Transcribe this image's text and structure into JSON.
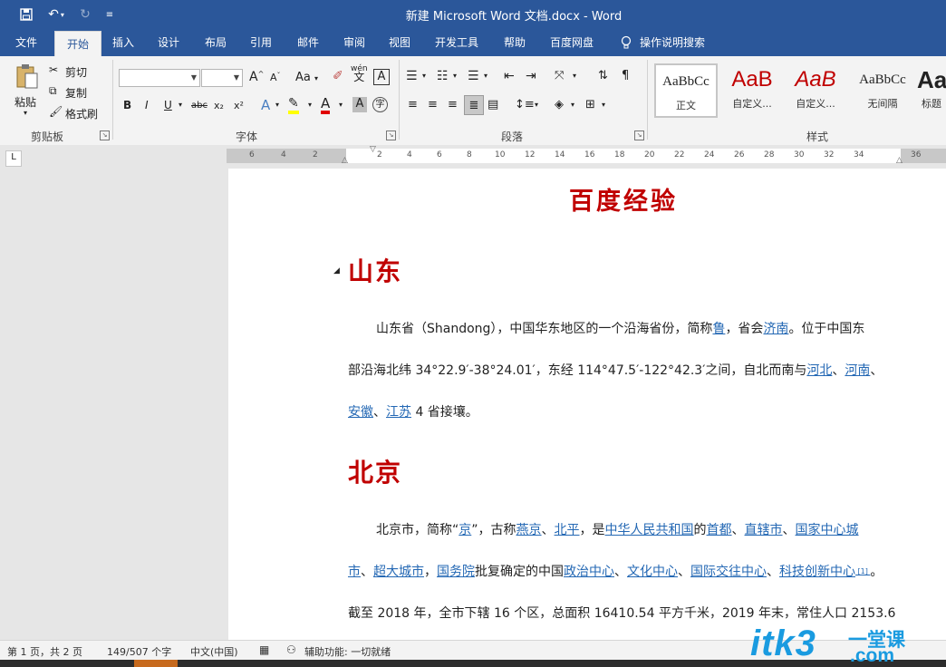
{
  "window": {
    "title": "新建 Microsoft Word 文档.docx  -  Word"
  },
  "tabs": [
    "文件",
    "开始",
    "插入",
    "设计",
    "布局",
    "引用",
    "邮件",
    "审阅",
    "视图",
    "开发工具",
    "帮助",
    "百度网盘"
  ],
  "tell_me": "操作说明搜索",
  "clipboard": {
    "paste": "粘贴",
    "cut": "剪切",
    "copy": "复制",
    "format_painter": "格式刷",
    "group": "剪贴板"
  },
  "font": {
    "group": "字体",
    "font_name": "",
    "font_size": "",
    "change_case": "Aa",
    "wen": "wén",
    "wen_char": "文",
    "char_border": "A",
    "grow": "A",
    "shrink": "A",
    "bold": "B",
    "italic": "I",
    "underline": "U",
    "strike": "abc",
    "subscript": "x₂",
    "superscript": "x²",
    "text_effects": "A",
    "font_color": "A",
    "char_shading": "A",
    "enclose": "字"
  },
  "paragraph": {
    "group": "段落"
  },
  "styles": {
    "group": "样式",
    "items": [
      {
        "preview": "AaBbCc",
        "name": "正文"
      },
      {
        "preview": "AaB",
        "name": "自定义..."
      },
      {
        "preview": "AaB",
        "name": "自定义..."
      },
      {
        "preview": "AaBbCc",
        "name": "无间隔"
      },
      {
        "preview": "Aa",
        "name": "标题"
      }
    ]
  },
  "ruler": {
    "left_labels": [
      "6",
      "4",
      "2"
    ],
    "right_labels": [
      "2",
      "4",
      "6",
      "8",
      "10",
      "12",
      "14",
      "16",
      "18",
      "20",
      "22",
      "24",
      "26",
      "28",
      "30",
      "32",
      "34",
      "36"
    ]
  },
  "document": {
    "title": "百度经验",
    "sections": [
      {
        "heading": "山东",
        "lines": [
          [
            {
              "t": "山东省（Shandong），中国华东地区的一个沿海省份，简称"
            },
            {
              "t": "鲁",
              "link": true
            },
            {
              "t": "，省会"
            },
            {
              "t": "济南",
              "link": true
            },
            {
              "t": "。位于中国东"
            }
          ],
          [
            {
              "t": "部沿海北纬 34°22.9′-38°24.01′，东经 114°47.5′-122°42.3′之间，自北而南与"
            },
            {
              "t": "河北",
              "link": true
            },
            {
              "t": "、"
            },
            {
              "t": "河南",
              "link": true
            },
            {
              "t": "、"
            }
          ],
          [
            {
              "t": "安徽",
              "link": true
            },
            {
              "t": "、"
            },
            {
              "t": "江苏",
              "link": true
            },
            {
              "t": " 4 省接壤。"
            }
          ]
        ]
      },
      {
        "heading": "北京",
        "lines": [
          [
            {
              "t": "北京市，简称“"
            },
            {
              "t": "京",
              "link": true
            },
            {
              "t": "”，古称"
            },
            {
              "t": "燕京",
              "link": true
            },
            {
              "t": "、"
            },
            {
              "t": "北平",
              "link": true
            },
            {
              "t": "，是"
            },
            {
              "t": "中华人民共和国",
              "link": true
            },
            {
              "t": "的"
            },
            {
              "t": "首都",
              "link": true
            },
            {
              "t": "、"
            },
            {
              "t": "直辖市",
              "link": true
            },
            {
              "t": "、"
            },
            {
              "t": "国家中心城",
              "link": true
            }
          ],
          [
            {
              "t": "市",
              "link": true
            },
            {
              "t": "、"
            },
            {
              "t": "超大城市",
              "link": true
            },
            {
              "t": "，"
            },
            {
              "t": "国务院",
              "link": true
            },
            {
              "t": "批复确定的中国"
            },
            {
              "t": "政治中心",
              "link": true
            },
            {
              "t": "、"
            },
            {
              "t": "文化中心",
              "link": true
            },
            {
              "t": "、"
            },
            {
              "t": "国际交往中心",
              "link": true
            },
            {
              "t": "、"
            },
            {
              "t": "科技创新中心",
              "link": true
            },
            {
              "t": " [1] ",
              "sup": true
            },
            {
              "t": "。"
            }
          ],
          [
            {
              "t": "截至 2018 年，全市下辖 16 个区，总面积 16410.54 平方千米，2019 年末，常住人口 2153.6"
            }
          ]
        ]
      }
    ]
  },
  "status": {
    "page": "第 1 页，共 2 页",
    "words": "149/507 个字",
    "language": "中文(中国)",
    "accessibility": "辅助功能: 一切就绪"
  },
  "watermark": {
    "brand": "itk3",
    "cn": "一堂课",
    "domain": ".com"
  },
  "colors": {
    "word_blue": "#2b579a",
    "heading_red": "#c00000",
    "link_blue": "#2468b4"
  }
}
